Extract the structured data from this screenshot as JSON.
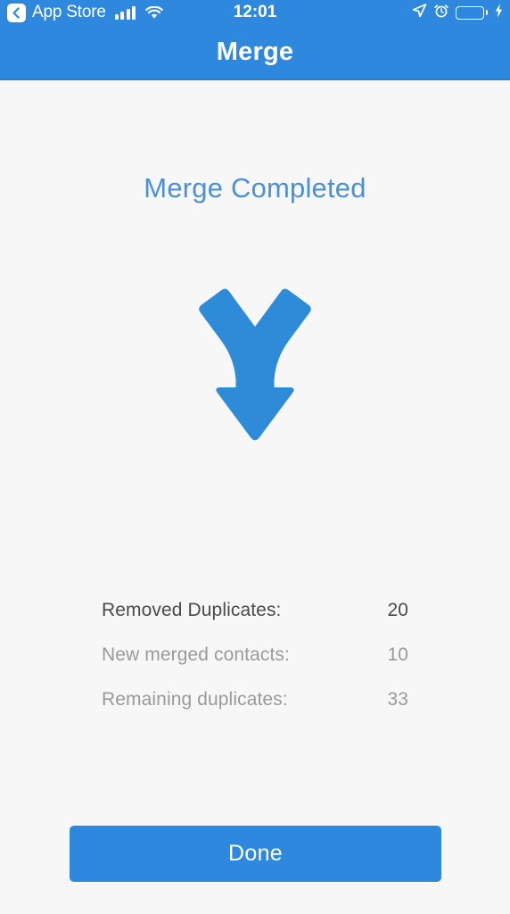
{
  "status_bar": {
    "back_icon": "back-chevron-icon",
    "carrier": "App Store",
    "signal_icon": "cellular-signal-icon",
    "wifi_icon": "wifi-icon",
    "time": "12:01",
    "location_icon": "location-arrow-icon",
    "alarm_icon": "alarm-clock-icon",
    "battery_icon": "battery-full-icon",
    "charging_icon": "lightning-bolt-icon",
    "battery_color": "#4cd964",
    "bar_color": "#2e89de"
  },
  "nav": {
    "title": "Merge"
  },
  "main": {
    "headline": "Merge Completed",
    "headline_color": "#4a90d9",
    "illustration_icon": "merge-arrow-icon",
    "illustration_color": "#2d8bd8",
    "stats": [
      {
        "label": "Removed Duplicates:",
        "value": "20",
        "emphasis": true
      },
      {
        "label": "New merged contacts:",
        "value": "10",
        "emphasis": false
      },
      {
        "label": "Remaining duplicates:",
        "value": "33",
        "emphasis": false
      }
    ]
  },
  "footer": {
    "done_label": "Done",
    "done_color": "#2e89de"
  }
}
